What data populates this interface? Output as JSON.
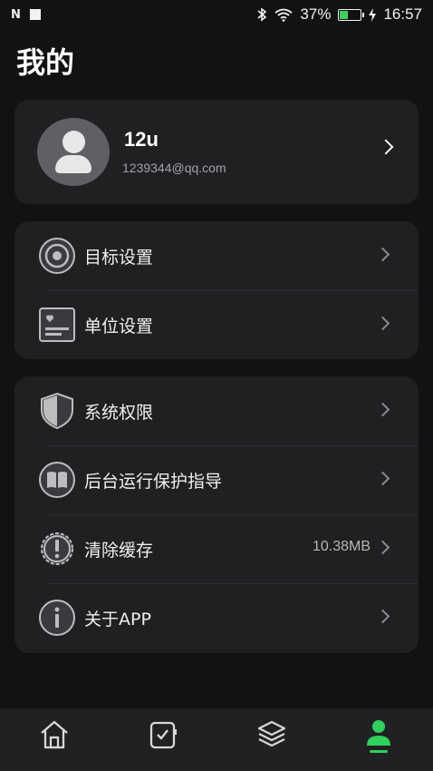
{
  "status_bar": {
    "nfc_label": "N",
    "battery_percent": "37%",
    "battery_level": 0.37,
    "time": "16:57"
  },
  "page_title": "我的",
  "profile": {
    "username": "12u",
    "email": "1239344@qq.com"
  },
  "group1": [
    {
      "label": "目标设置",
      "icon": "target-icon"
    },
    {
      "label": "单位设置",
      "icon": "unit-card-icon"
    }
  ],
  "group2": [
    {
      "label": "系统权限",
      "icon": "shield-icon"
    },
    {
      "label": "后台运行保护指导",
      "icon": "book-icon"
    },
    {
      "label": "清除缓存",
      "icon": "alert-gear-icon",
      "value": "10.38MB"
    },
    {
      "label": "关于APP",
      "icon": "info-icon"
    }
  ],
  "tabbar": {
    "items": [
      {
        "icon": "home-icon",
        "active": false
      },
      {
        "icon": "watch-icon",
        "active": false
      },
      {
        "icon": "layers-icon",
        "active": false
      },
      {
        "icon": "profile-icon",
        "active": true
      }
    ],
    "active_color": "#2ed15b",
    "inactive_color": "#d8d8d8"
  }
}
